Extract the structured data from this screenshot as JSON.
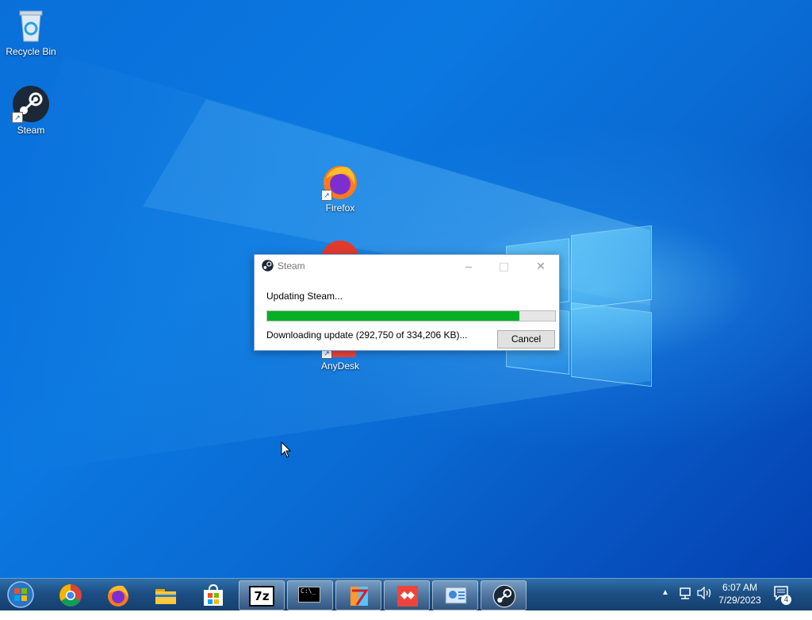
{
  "desktop": {
    "icons": [
      {
        "label": "Recycle Bin",
        "icon": "recycle-bin-icon"
      },
      {
        "label": "Steam",
        "icon": "steam-icon"
      },
      {
        "label": "Firefox",
        "icon": "firefox-icon"
      },
      {
        "label": "AnyDesk",
        "icon": "anydesk-icon"
      }
    ]
  },
  "dialog": {
    "title": "Steam",
    "status": "Updating Steam...",
    "detail": "Downloading update (292,750 of 334,206 KB)...",
    "progress_fraction": 0.876,
    "cancel_label": "Cancel"
  },
  "taskbar": {
    "apps": [
      {
        "name": "Google Chrome",
        "icon": "chrome-icon"
      },
      {
        "name": "Firefox",
        "icon": "firefox-icon"
      },
      {
        "name": "File Explorer",
        "icon": "folder-icon"
      },
      {
        "name": "Microsoft Store",
        "icon": "store-icon"
      },
      {
        "name": "7-Zip",
        "icon": "7zip-icon",
        "label": "7z"
      },
      {
        "name": "Command Prompt",
        "icon": "cmd-icon",
        "label": "C:\\_"
      },
      {
        "name": "WinRAR/Unknown",
        "icon": "app-icon"
      },
      {
        "name": "AnyDesk",
        "icon": "anydesk-icon"
      },
      {
        "name": "Control Panel",
        "icon": "control-panel-icon"
      },
      {
        "name": "Steam",
        "icon": "steam-icon"
      }
    ],
    "clock_time": "6:07 AM",
    "clock_date": "7/29/2023",
    "notification_count": "4"
  },
  "colors": {
    "progress_fill": "#06b025",
    "desktop_blue": "#0a6fd9"
  }
}
